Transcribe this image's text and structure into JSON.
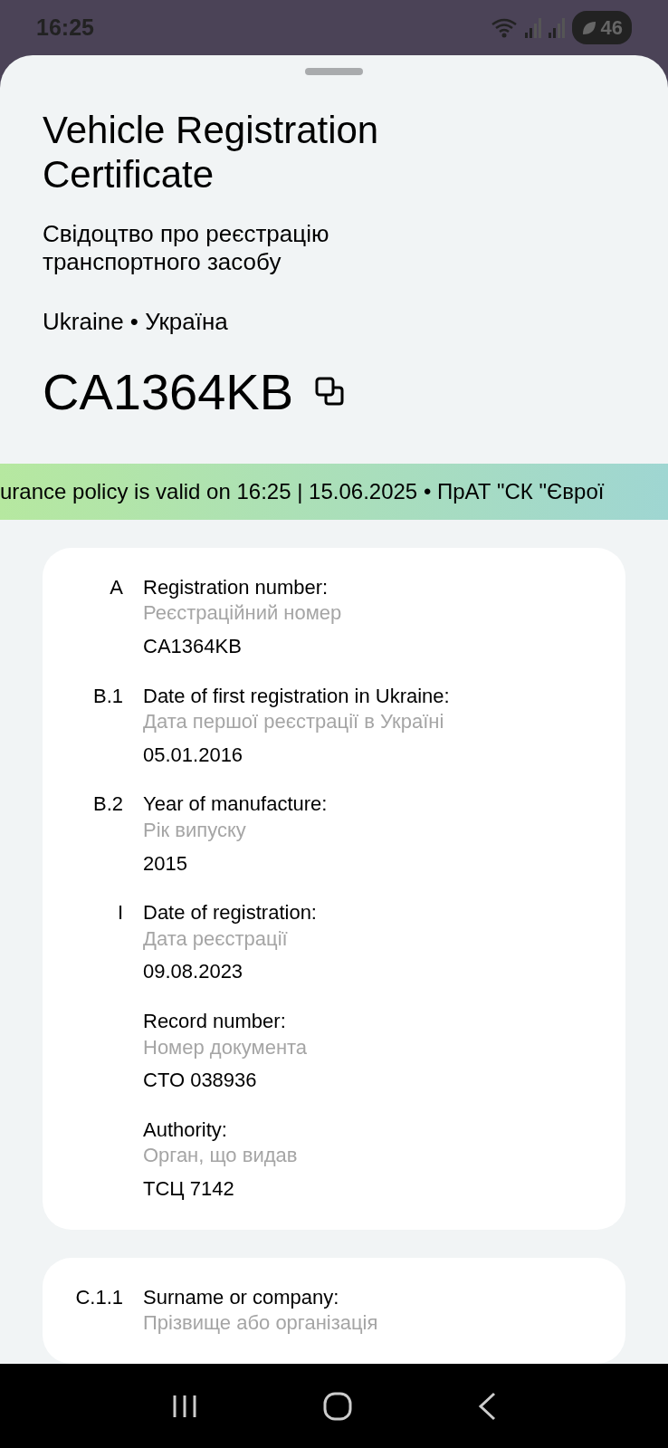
{
  "status_bar": {
    "time": "16:25",
    "battery": "46"
  },
  "header": {
    "title": "Vehicle Registration Certificate",
    "subtitle": "Свідоцтво про реєстрацію транспортного засобу",
    "country": "Ukraine • Україна",
    "plate": "CA1364KB"
  },
  "ticker": {
    "text": "urance policy is valid on 16:25 | 15.06.2025 • ПрАТ \"СК \"Єврої"
  },
  "cards": [
    {
      "fields": [
        {
          "code": "A",
          "label": "Registration number:",
          "label_uk": "Реєстраційний номер",
          "value": "CA1364KB"
        },
        {
          "code": "B.1",
          "label": "Date of first registration in Ukraine:",
          "label_uk": "Дата першої реєстрації в Україні",
          "value": "05.01.2016"
        },
        {
          "code": "B.2",
          "label": "Year of manufacture:",
          "label_uk": "Рік випуску",
          "value": "2015"
        },
        {
          "code": "I",
          "label": "Date of registration:",
          "label_uk": "Дата реєстрації",
          "value": "09.08.2023"
        },
        {
          "label": "Record number:",
          "label_uk": "Номер документа",
          "value": "CTO 038936"
        },
        {
          "label": "Authority:",
          "label_uk": "Орган, що видав",
          "value": "ТСЦ 7142"
        }
      ]
    },
    {
      "fields": [
        {
          "code": "C.1.1",
          "label": "Surname or company:",
          "label_uk": "Прізвище або організація"
        }
      ]
    }
  ]
}
